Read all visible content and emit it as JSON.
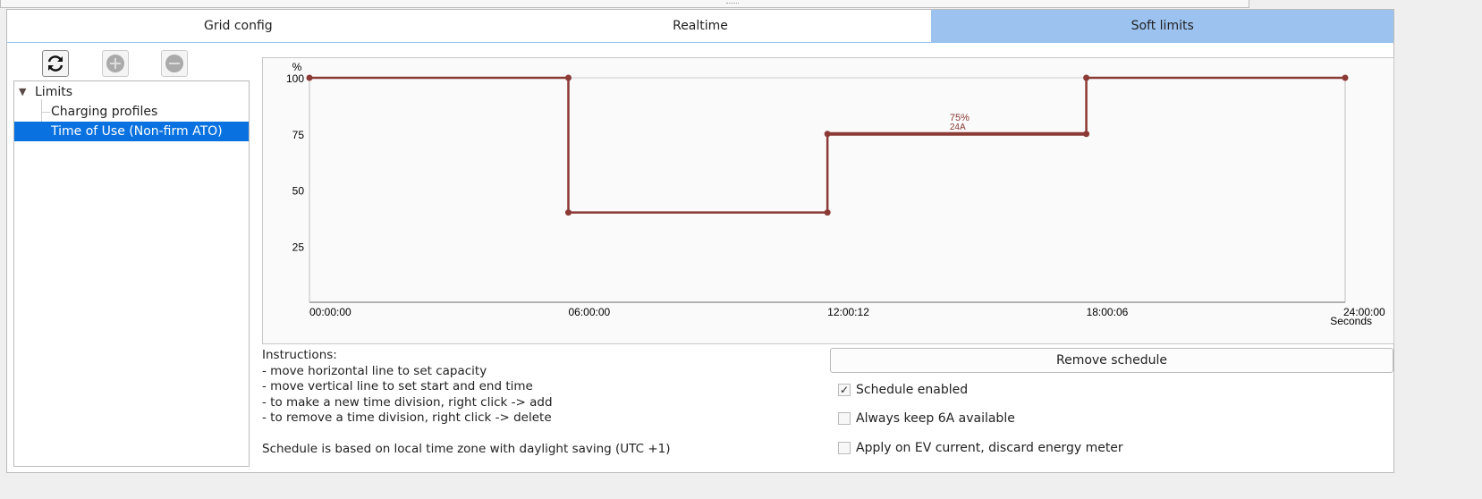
{
  "tabs": [
    {
      "label": "Grid config"
    },
    {
      "label": "Realtime"
    },
    {
      "label": "Soft limits",
      "active": true
    }
  ],
  "toolbar": {
    "refresh": "refresh-icon",
    "add": "plus-icon",
    "remove": "minus-icon"
  },
  "tree": {
    "root": "Limits",
    "children": [
      "Charging profiles",
      "Time of Use (Non-firm ATO)"
    ],
    "selected": "Time of Use (Non-firm ATO)"
  },
  "chart_data": {
    "type": "line",
    "step": true,
    "ylabel": "%",
    "xlabel": "Seconds",
    "ylim": [
      0,
      100
    ],
    "xlim_hours": [
      0,
      24
    ],
    "yticks": [
      "100",
      "75",
      "50",
      "25"
    ],
    "xticks": [
      {
        "h": 0,
        "label": "00:00:00"
      },
      {
        "h": 6,
        "label": "06:00:00"
      },
      {
        "h": 12.0033,
        "label": "12:00:12"
      },
      {
        "h": 18.0017,
        "label": "18:00:06"
      },
      {
        "h": 24,
        "label": "24:00:00"
      }
    ],
    "points": [
      [
        0,
        100
      ],
      [
        6,
        100
      ],
      [
        6,
        40
      ],
      [
        12.0033,
        40
      ],
      [
        12.0033,
        75
      ],
      [
        18.0017,
        75
      ],
      [
        18.0017,
        100
      ],
      [
        24,
        100
      ]
    ],
    "selected_segment": {
      "from": 12.0033,
      "to": 18.0017,
      "value": 75,
      "label_pct": "75%",
      "label_amp": "24A"
    },
    "color": "#8b3a36"
  },
  "instructions": "Instructions:\n- move horizontal line to set capacity\n- move vertical line to set start and end time\n- to make a new time division, right click -> add\n- to remove a time division, right click -> delete\n\nSchedule is based on local time zone with daylight saving (UTC +1)",
  "remove_schedule": "Remove schedule",
  "options": [
    {
      "label": "Schedule enabled",
      "checked": true
    },
    {
      "label": "Always keep 6A available",
      "checked": false
    },
    {
      "label": "Apply on EV current, discard energy meter",
      "checked": false
    }
  ]
}
